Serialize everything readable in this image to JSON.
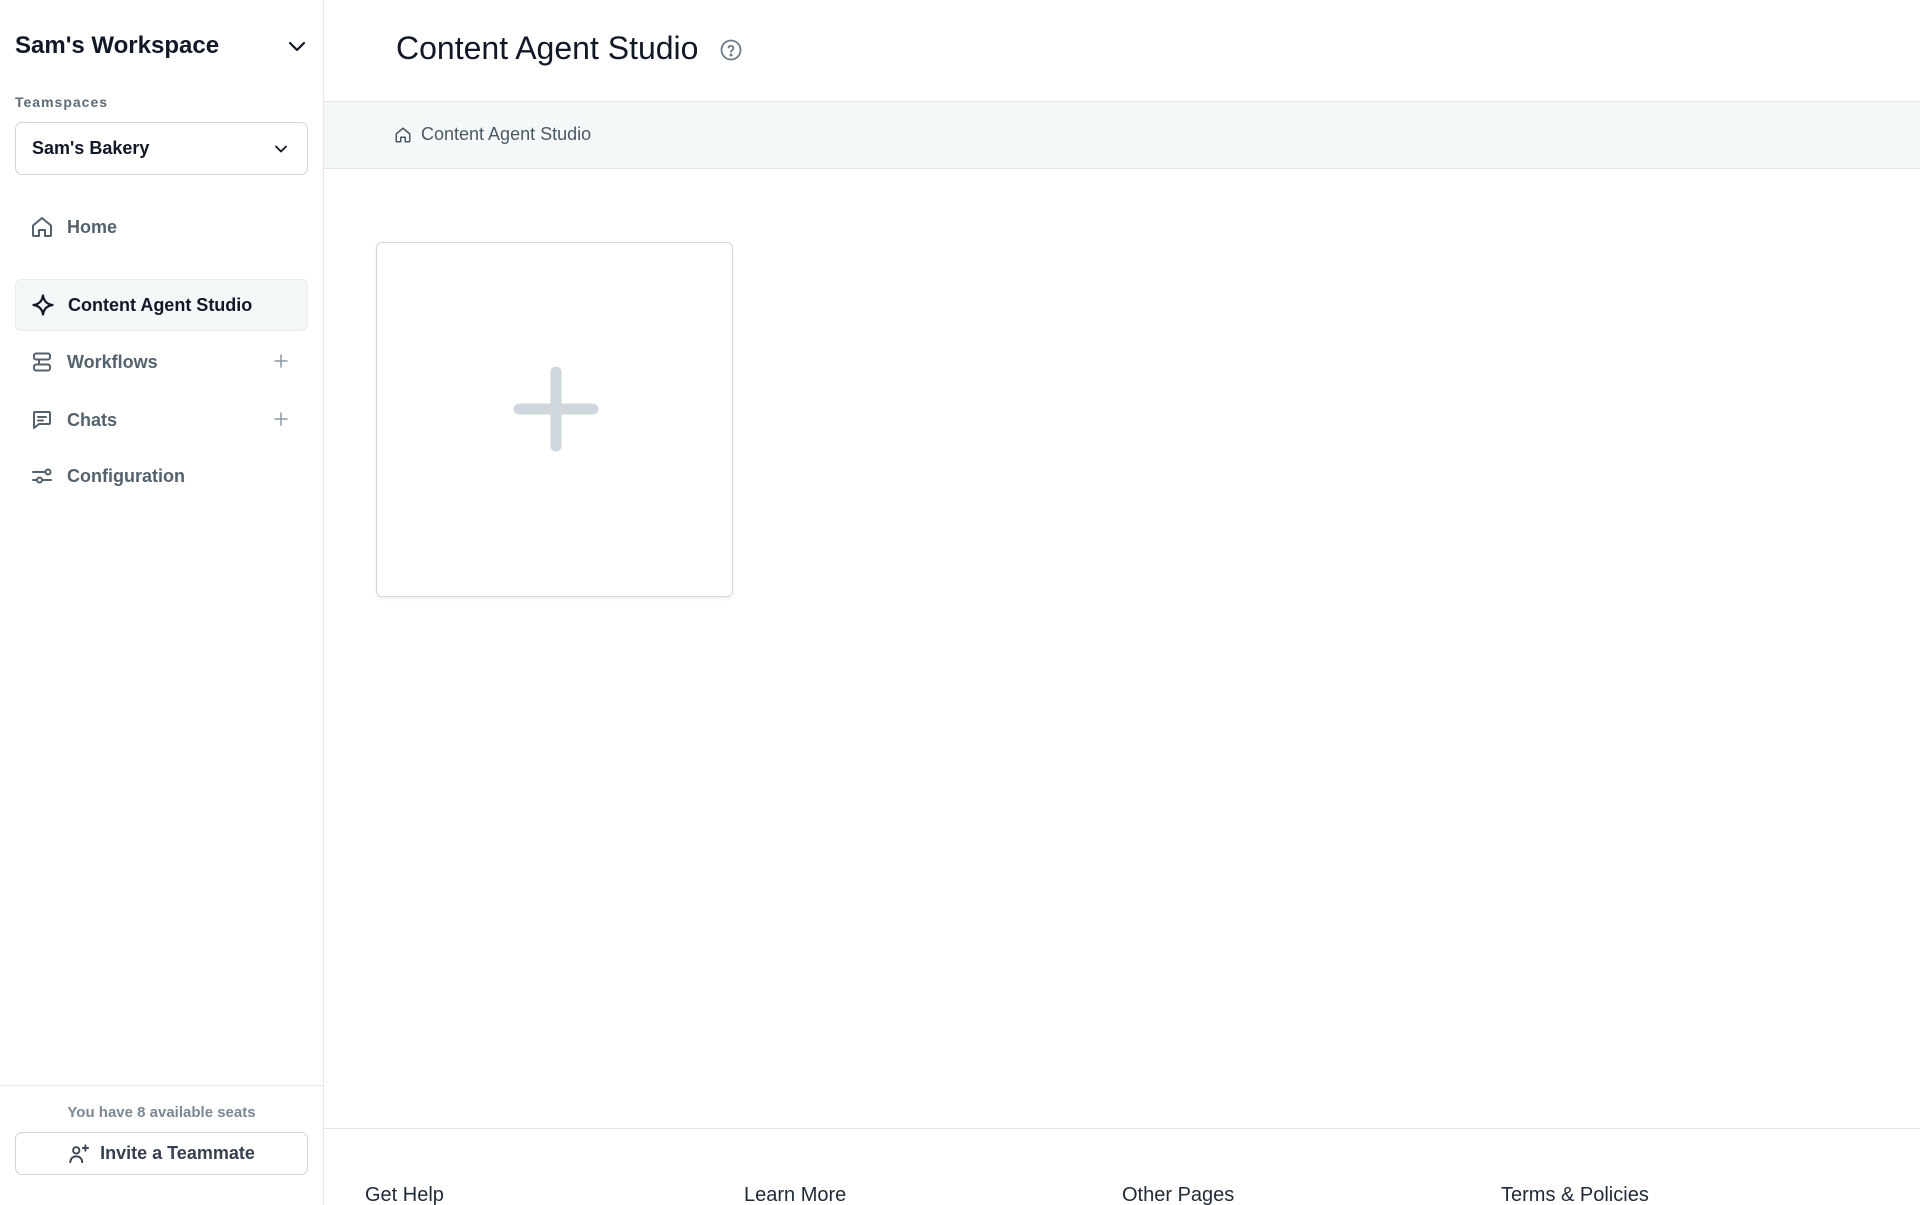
{
  "sidebar": {
    "workspace_title": "Sam's Workspace",
    "teamspaces_label": "Teamspaces",
    "teamspace_selected": "Sam's Bakery",
    "items": [
      {
        "label": "Home",
        "icon": "home-icon"
      },
      {
        "label": "Content Agent Studio",
        "icon": "sparkle-icon",
        "active": true
      },
      {
        "label": "Workflows",
        "icon": "workflow-icon"
      },
      {
        "label": "Chats",
        "icon": "chat-icon"
      },
      {
        "label": "Configuration",
        "icon": "sliders-icon"
      }
    ],
    "seats_text": "You have 8 available seats",
    "invite_label": "Invite a Teammate"
  },
  "header": {
    "title": "Content Agent Studio",
    "help_icon": "help-circle-icon"
  },
  "breadcrumb": {
    "label": "Content Agent Studio",
    "icon": "home-icon"
  },
  "main": {
    "add_card_icon": "plus-icon"
  },
  "footer": {
    "columns": [
      "Get Help",
      "Learn More",
      "Other Pages",
      "Terms & Policies"
    ]
  },
  "colors": {
    "sidebar_text": "#54626e",
    "active_bg": "#f4f7f8",
    "border": "#e3e8ec",
    "plus_icon": "#cfd7dd"
  }
}
